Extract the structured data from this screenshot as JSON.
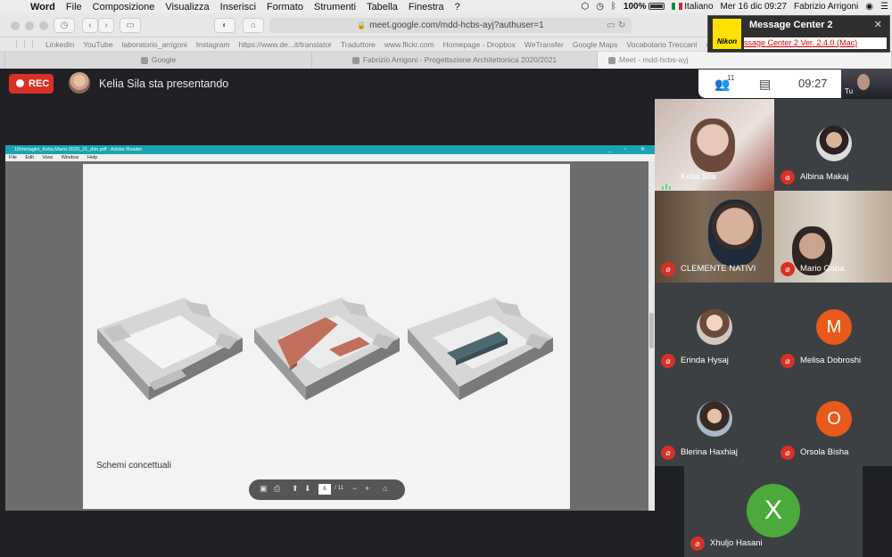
{
  "menubar": {
    "app": "Word",
    "items": [
      "File",
      "Composizione",
      "Visualizza",
      "Inserisci",
      "Formato",
      "Strumenti",
      "Tabella",
      "Finestra",
      "?"
    ],
    "battery": "100%",
    "language": "Italiano",
    "datetime": "Mer 16 dic  09:27",
    "user": "Fabrizio Arrigoni"
  },
  "browser": {
    "url": "meet.google.com/mdd-hcbs-ayj?authuser=1",
    "bookmarks": [
      "LinkedIn",
      "YouTube",
      "laboratorio_arrigoni",
      "Instagram",
      "https://www.de...it/translator",
      "Traduttore",
      "www.flickr.com",
      "Homepage - Dropbox",
      "WeTransfer",
      "Google Maps",
      "Vocabolario Treccani",
      "webmail"
    ],
    "tabs": [
      "Google",
      "Fabrizio Arrigoni - Progettazione Architettonica 2020/2021",
      "Meet - mdd-hcbs-ayj"
    ]
  },
  "nikon": {
    "title": "Message Center 2",
    "link": "ssage Center 2 Ver. 2.4.0 (Mac)",
    "logo": "Nikon"
  },
  "meet": {
    "rec_label": "REC",
    "presenter_text": "Kelia Sila sta presentando",
    "participants_count": "11",
    "time": "09:27",
    "self_label": "Tu"
  },
  "reader": {
    "title": "10Immagini_Kelia.Mario-2020_21_dim.pdf - Adobe Reader",
    "menus": [
      "File",
      "Edit",
      "View",
      "Window",
      "Help"
    ],
    "caption": "Schemi concettuali",
    "page_current": "6",
    "page_total": "/ 11"
  },
  "participants": [
    {
      "name": "Kelia Sila",
      "muted": false,
      "kind": "video"
    },
    {
      "name": "Albina Makaj",
      "muted": true,
      "kind": "photo"
    },
    {
      "name": "CLEMENTE NATIVI",
      "muted": true,
      "kind": "video"
    },
    {
      "name": "Mario Gaba",
      "muted": true,
      "kind": "video"
    },
    {
      "name": "Erinda Hysaj",
      "muted": true,
      "kind": "photo"
    },
    {
      "name": "Melisa Dobroshi",
      "muted": true,
      "kind": "initial",
      "initial": "M",
      "color": "#e8591b"
    },
    {
      "name": "Blerina Haxhiaj",
      "muted": true,
      "kind": "photo"
    },
    {
      "name": "Orsola Bisha",
      "muted": true,
      "kind": "initial",
      "initial": "O",
      "color": "#e8591b"
    },
    {
      "name": "Xhuljo Hasani",
      "muted": true,
      "kind": "initial",
      "initial": "X",
      "color": "#4caa3c"
    }
  ],
  "colors": {
    "rec_red": "#d93025",
    "reader_title": "#19a3b3",
    "mass_orange": "#c0705a",
    "mass_teal": "#4d6870"
  }
}
